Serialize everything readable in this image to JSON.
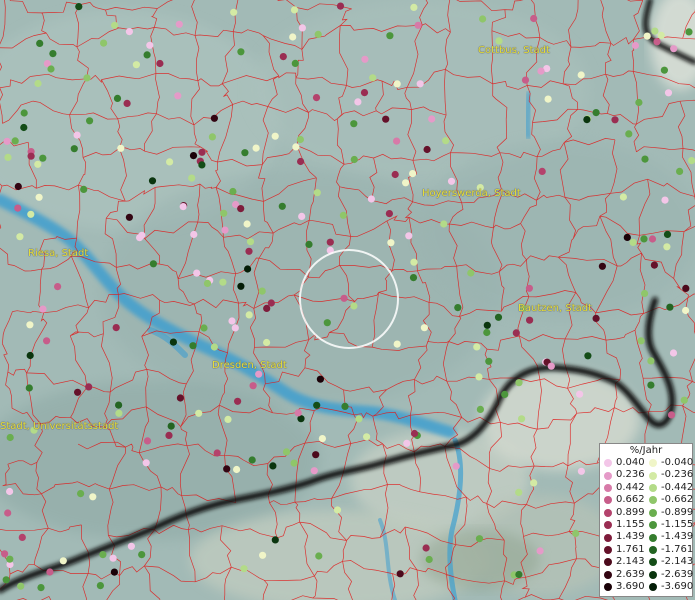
{
  "cities": [
    {
      "id": "cottbus",
      "label": "Cottbus, Stadt"
    },
    {
      "id": "hoyerswerda",
      "label": "Hoyerswerda, Stadt"
    },
    {
      "id": "riesa",
      "label": "Riesa, Stadt"
    },
    {
      "id": "bautzen",
      "label": "Bautzen, Stadt"
    },
    {
      "id": "dresden",
      "label": "Dresden, Stadt"
    },
    {
      "id": "universitaetsstadt",
      "label": "Stadt, Universitätsstadt"
    }
  ],
  "legend": {
    "title": "%/Jahr",
    "positive": [
      {
        "label": "0.040",
        "color": "#f3c6e8"
      },
      {
        "label": "0.236",
        "color": "#e59ac8"
      },
      {
        "label": "0.442",
        "color": "#d77aa8"
      },
      {
        "label": "0.662",
        "color": "#c75d8a"
      },
      {
        "label": "0.899",
        "color": "#b4426c"
      },
      {
        "label": "1.155",
        "color": "#9a2d52"
      },
      {
        "label": "1.439",
        "color": "#7e1c3b"
      },
      {
        "label": "1.761",
        "color": "#65112a"
      },
      {
        "label": "2.143",
        "color": "#4c0a1c"
      },
      {
        "label": "2.639",
        "color": "#330512"
      },
      {
        "label": "3.690",
        "color": "#1a0208"
      }
    ],
    "negative": [
      {
        "label": "-0.040",
        "color": "#f0f5c8"
      },
      {
        "label": "-0.236",
        "color": "#d3eaa4"
      },
      {
        "label": "-0.442",
        "color": "#b3db88"
      },
      {
        "label": "-0.662",
        "color": "#8fc66a"
      },
      {
        "label": "-0.899",
        "color": "#6aae4f"
      },
      {
        "label": "-1.155",
        "color": "#4c963c"
      },
      {
        "label": "-1.439",
        "color": "#357d2e"
      },
      {
        "label": "-1.761",
        "color": "#236522"
      },
      {
        "label": "-2.143",
        "color": "#144d17"
      },
      {
        "label": "-2.639",
        "color": "#0a350e"
      },
      {
        "label": "-3.690",
        "color": "#031d06"
      }
    ]
  },
  "colors": {
    "background": "#9fb8b5",
    "boundary_lines": "#e01818",
    "river": "#3f9fcf",
    "border_outline": "#1a1a1a",
    "city_label": "#e6e03a",
    "highlight_ring": "#ffffff"
  }
}
